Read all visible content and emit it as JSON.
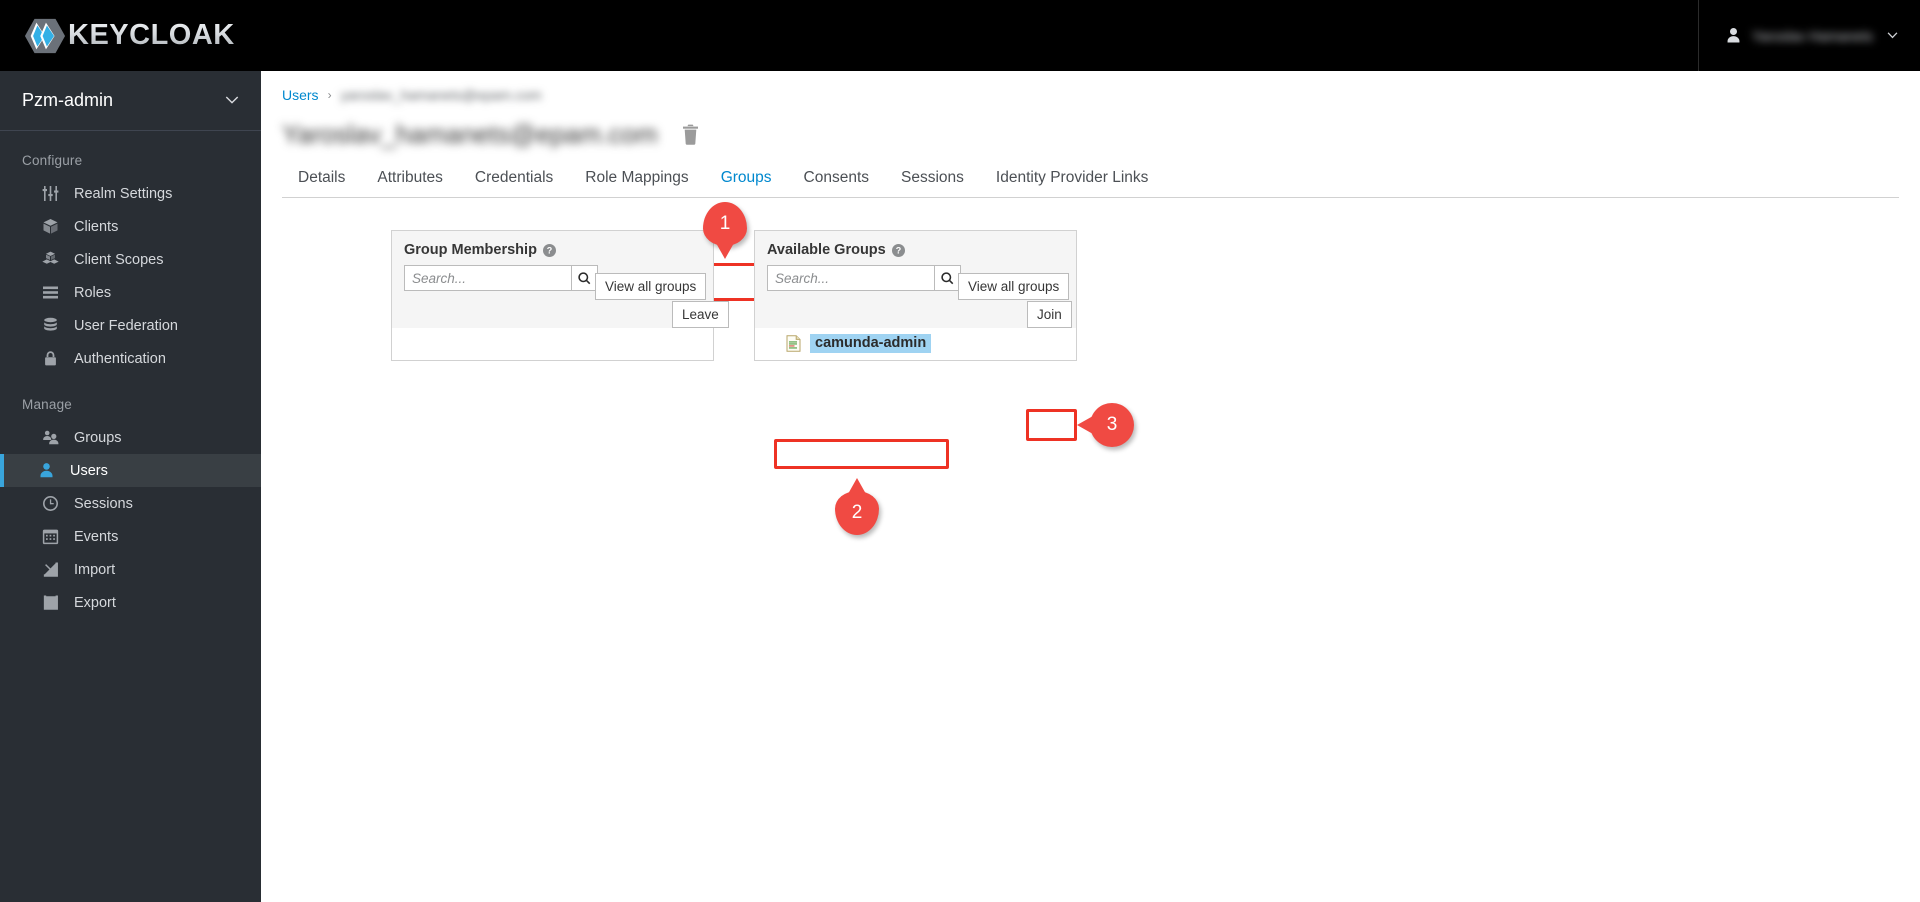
{
  "masthead": {
    "brand": "KEYCLOAK",
    "logo_icon": "keycloak-hexagon-logo",
    "user_icon": "user-avatar-icon",
    "user_name": "Yaroslav Hamanets",
    "caret_icon": "chevron-down-icon"
  },
  "sidebar": {
    "realm": "Pzm-admin",
    "realm_caret_icon": "chevron-down-icon",
    "sections": [
      {
        "label": "Configure",
        "items": [
          {
            "label": "Realm Settings",
            "icon": "sliders-icon",
            "active": false
          },
          {
            "label": "Clients",
            "icon": "cube-icon",
            "active": false
          },
          {
            "label": "Client Scopes",
            "icon": "cubes-icon",
            "active": false
          },
          {
            "label": "Roles",
            "icon": "list-bars-icon",
            "active": false
          },
          {
            "label": "User Federation",
            "icon": "database-icon",
            "active": false
          },
          {
            "label": "Authentication",
            "icon": "lock-icon",
            "active": false
          }
        ]
      },
      {
        "label": "Manage",
        "items": [
          {
            "label": "Groups",
            "icon": "users-group-icon",
            "active": false
          },
          {
            "label": "Users",
            "icon": "user-icon",
            "active": true
          },
          {
            "label": "Sessions",
            "icon": "clock-icon",
            "active": false
          },
          {
            "label": "Events",
            "icon": "calendar-icon",
            "active": false
          },
          {
            "label": "Import",
            "icon": "import-arrow-icon",
            "active": false
          },
          {
            "label": "Export",
            "icon": "export-arrow-icon",
            "active": false
          }
        ]
      }
    ]
  },
  "breadcrumb": {
    "root": "Users",
    "separator": "›",
    "current": "yaroslav_hamanets@epam.com"
  },
  "page": {
    "title": "Yaroslav_hamanets@epam.com",
    "delete_icon": "trash-icon"
  },
  "tabs": [
    {
      "label": "Details",
      "active": false
    },
    {
      "label": "Attributes",
      "active": false
    },
    {
      "label": "Credentials",
      "active": false
    },
    {
      "label": "Role Mappings",
      "active": false
    },
    {
      "label": "Groups",
      "active": true
    },
    {
      "label": "Consents",
      "active": false
    },
    {
      "label": "Sessions",
      "active": false
    },
    {
      "label": "Identity Provider Links",
      "active": false
    }
  ],
  "group_membership": {
    "title": "Group Membership",
    "help_icon": "help-circle-icon",
    "search_placeholder": "Search...",
    "search_value": "",
    "search_icon": "magnifier-icon",
    "view_all_label": "View all groups",
    "leave_label": "Leave",
    "items": []
  },
  "available_groups": {
    "title": "Available Groups",
    "help_icon": "help-circle-icon",
    "search_placeholder": "Search...",
    "search_value": "",
    "search_icon": "magnifier-icon",
    "view_all_label": "View all groups",
    "join_label": "Join",
    "items": [
      {
        "label": "camunda-admin",
        "icon": "document-icon",
        "selected": true
      }
    ]
  },
  "annotations": {
    "marker_color": "#f04a43",
    "highlight_color": "#ee3224",
    "markers": [
      {
        "number": "1",
        "target": "tab-groups"
      },
      {
        "number": "2",
        "target": "list-item-camunda-admin"
      },
      {
        "number": "3",
        "target": "join-button"
      }
    ]
  }
}
